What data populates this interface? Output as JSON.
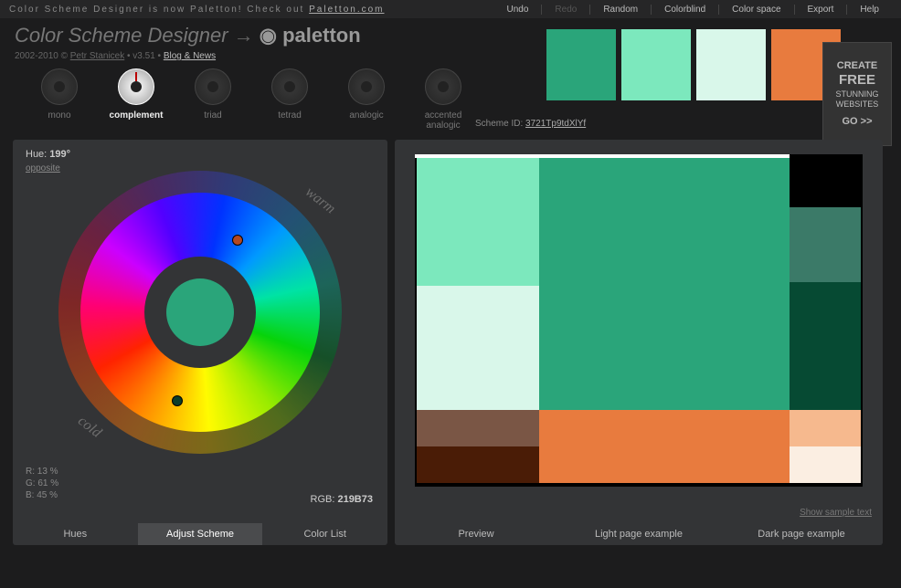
{
  "top": {
    "notice_prefix": "Color Scheme Designer is now Paletton! Check out ",
    "notice_link": "Paletton.com",
    "nav": {
      "undo": "Undo",
      "redo": "Redo",
      "random": "Random",
      "colorblind": "Colorblind",
      "colorspace": "Color space",
      "export": "Export",
      "help": "Help"
    }
  },
  "brand": {
    "title_a": "Color Scheme Designer",
    "arrow": "→",
    "title_b": "◉ paletton"
  },
  "sub": {
    "years": "2002-2010 © ",
    "author": "Petr Stanicek",
    "version": " • v3.51 • ",
    "blog": "Blog & News"
  },
  "modes": {
    "mono": "mono",
    "complement": "complement",
    "triad": "triad",
    "tetrad": "tetrad",
    "analogic": "analogic",
    "accented": "accented analogic"
  },
  "swatches": [
    "#2aa57a",
    "#7ce8bd",
    "#d9f7ea",
    "#e87b3e"
  ],
  "scheme": {
    "label": "Scheme ID: ",
    "id": "3721Tp9tdXlYf"
  },
  "promo": {
    "l1": "CREATE",
    "l2": "FREE",
    "l3": "STUNNING",
    "l4": "WEBSITES",
    "go": "GO >>"
  },
  "hue": {
    "label": "Hue: ",
    "value": "199°",
    "opposite": "opposite"
  },
  "rgb_pct": {
    "r": "R: 13 %",
    "g": "G: 61 %",
    "b": "B: 45 %"
  },
  "rgb_hex": {
    "label": "RGB: ",
    "value": "219B73"
  },
  "wheel": {
    "warm": "warm",
    "cold": "cold"
  },
  "tabs_left": {
    "hues": "Hues",
    "adjust": "Adjust Scheme",
    "list": "Color List"
  },
  "tabs_right": {
    "preview": "Preview",
    "light": "Light page example",
    "dark": "Dark page example"
  },
  "sample_text": "Show sample text",
  "preview_colors": {
    "main": "#2aa57a",
    "light": "#7ce8bd",
    "lighter": "#d9f7ea",
    "dark_teal": "#3b7a68",
    "darker_teal": "#064a33",
    "brown": "#7a5645",
    "orange": "#e87b3e",
    "peach": "#f6b98e",
    "dark_brown": "#4a1c06",
    "cream": "#fbeee2"
  }
}
